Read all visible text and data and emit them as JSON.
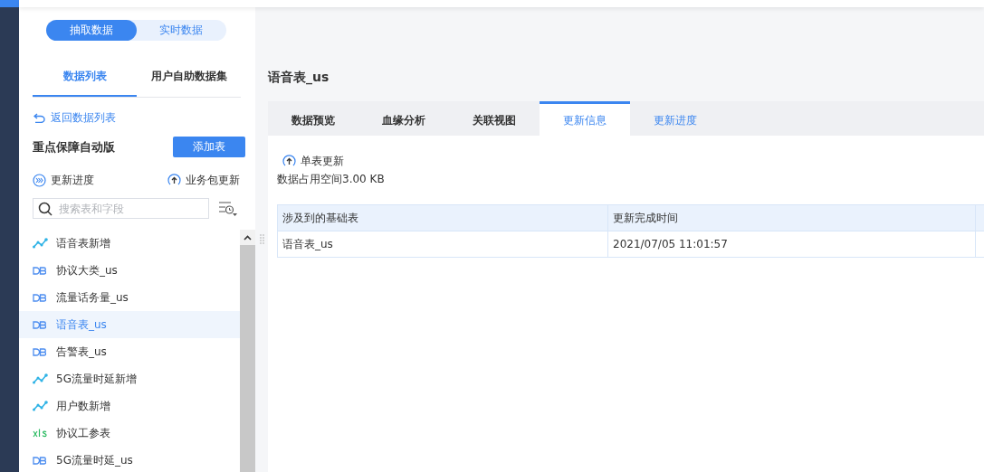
{
  "mode_toggle": [
    {
      "label": "抽取数据",
      "selected": true
    },
    {
      "label": "实时数据",
      "selected": false
    }
  ],
  "panel_tabs": [
    {
      "label": "数据列表",
      "selected": true
    },
    {
      "label": "用户自助数据集",
      "selected": false
    }
  ],
  "back_link": "返回数据列表",
  "package": {
    "title": "重点保障自动版",
    "add_button": "添加表",
    "progress_link": "更新进度",
    "package_update": "业务包更新"
  },
  "search": {
    "placeholder": "搜索表和字段"
  },
  "tables": [
    {
      "kind": "trend",
      "name": "语音表新增",
      "selected": false
    },
    {
      "kind": "db",
      "name": "协议大类_us",
      "selected": false
    },
    {
      "kind": "db",
      "name": "流量话务量_us",
      "selected": false
    },
    {
      "kind": "db",
      "name": "语音表_us",
      "selected": true
    },
    {
      "kind": "db",
      "name": "告警表_us",
      "selected": false
    },
    {
      "kind": "trend",
      "name": "5G流量时延新增",
      "selected": false
    },
    {
      "kind": "trend",
      "name": "用户数新增",
      "selected": false
    },
    {
      "kind": "xls",
      "name": "协议工参表",
      "selected": false
    },
    {
      "kind": "db",
      "name": "5G流量时延_us",
      "selected": false
    }
  ],
  "detail": {
    "title": "语音表_us",
    "tabs": [
      {
        "label": "数据预览",
        "selected": false
      },
      {
        "label": "血缘分析",
        "selected": false
      },
      {
        "label": "关联视图",
        "selected": false
      },
      {
        "label": "更新信息",
        "selected": true
      },
      {
        "label": "更新进度",
        "selected": false,
        "kind": "link"
      }
    ],
    "single_update": "单表更新",
    "space": "数据占用空间3.00 KB",
    "table": {
      "columns": [
        "涉及到的基础表",
        "更新完成时间"
      ],
      "rows": [
        [
          "语音表_us",
          "2021/07/05 11:01:57"
        ]
      ]
    }
  }
}
